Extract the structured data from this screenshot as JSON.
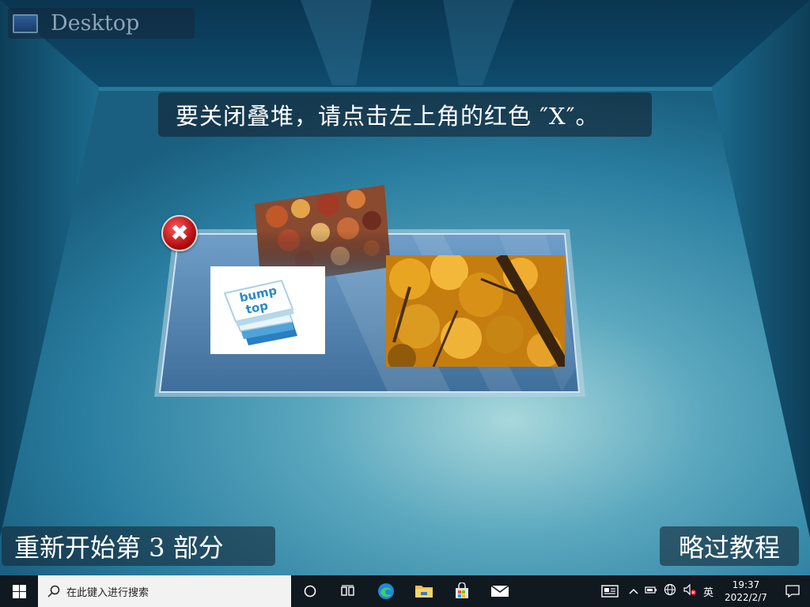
{
  "desktop": {
    "label": "Desktop"
  },
  "tutorial": {
    "instruction": "要关闭叠堆，请点击左上角的红色 ″X″。",
    "restart_label": "重新开始第 3 部分",
    "skip_label": "略过教程"
  },
  "pile": {
    "close_glyph": "✖",
    "bump_logo_line1": "bump",
    "bump_logo_line2": "top"
  },
  "taskbar": {
    "search_placeholder": "在此键入进行搜索",
    "ime": "英",
    "time": "19:37",
    "date": "2022/2/7"
  },
  "colors": {
    "close_red": "#c81414",
    "accent_blue": "#1f8ad1"
  }
}
